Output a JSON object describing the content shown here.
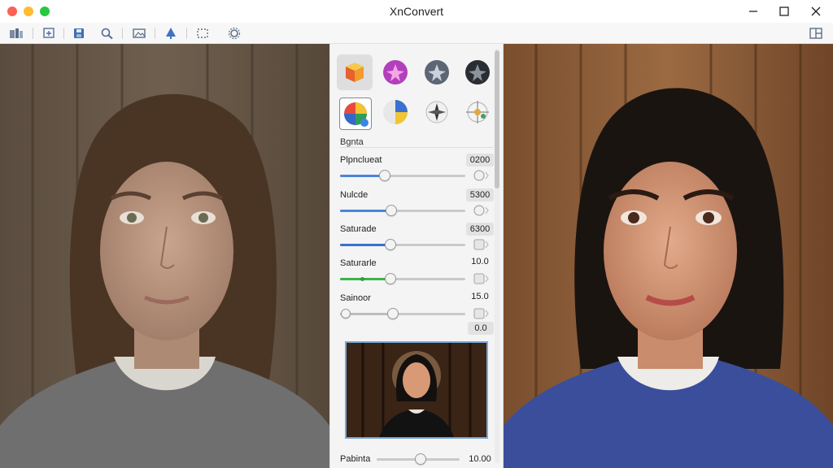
{
  "window": {
    "title": "XnConvert"
  },
  "toolbar": {
    "icons": [
      "browse-icon",
      "export-icon",
      "save-icon",
      "zoom-icon",
      "image-icon",
      "sharpen-icon",
      "crop-icon",
      "settings-icon",
      "layout-icon"
    ]
  },
  "panel": {
    "presets": [
      "cube-preset",
      "pink-star-preset",
      "gray-star-preset",
      "dark-star-preset",
      "color-wheel-preset",
      "half-wheel-preset",
      "compass-preset",
      "target-preset"
    ],
    "section_label": "Bgnta",
    "sliders": [
      {
        "label": "Plpnclueat",
        "value": "0200",
        "level": 0.36,
        "fill_color": "#4a86d8"
      },
      {
        "label": "Nulcde",
        "value": "5300",
        "level": 0.41,
        "fill_color": "#4a86d8"
      },
      {
        "label": "Saturade",
        "value": "6300",
        "level": 0.4,
        "fill_color": "#3a6fd0"
      },
      {
        "label": "Saturarle",
        "value": "10.0",
        "level": 0.4,
        "fill_color": "#3cb34a"
      },
      {
        "label": "Sainoor",
        "value": "15.0",
        "level": 0.42,
        "fill_color": "#bdbdbd"
      }
    ],
    "extra_value": "0.0",
    "bottom_slider": {
      "label": "Pabinta",
      "value": "10.00",
      "level": 0.53
    }
  },
  "colors": {
    "accent": "#4a86d8",
    "green": "#3cb34a",
    "panel_bg": "#f4f4f4"
  }
}
